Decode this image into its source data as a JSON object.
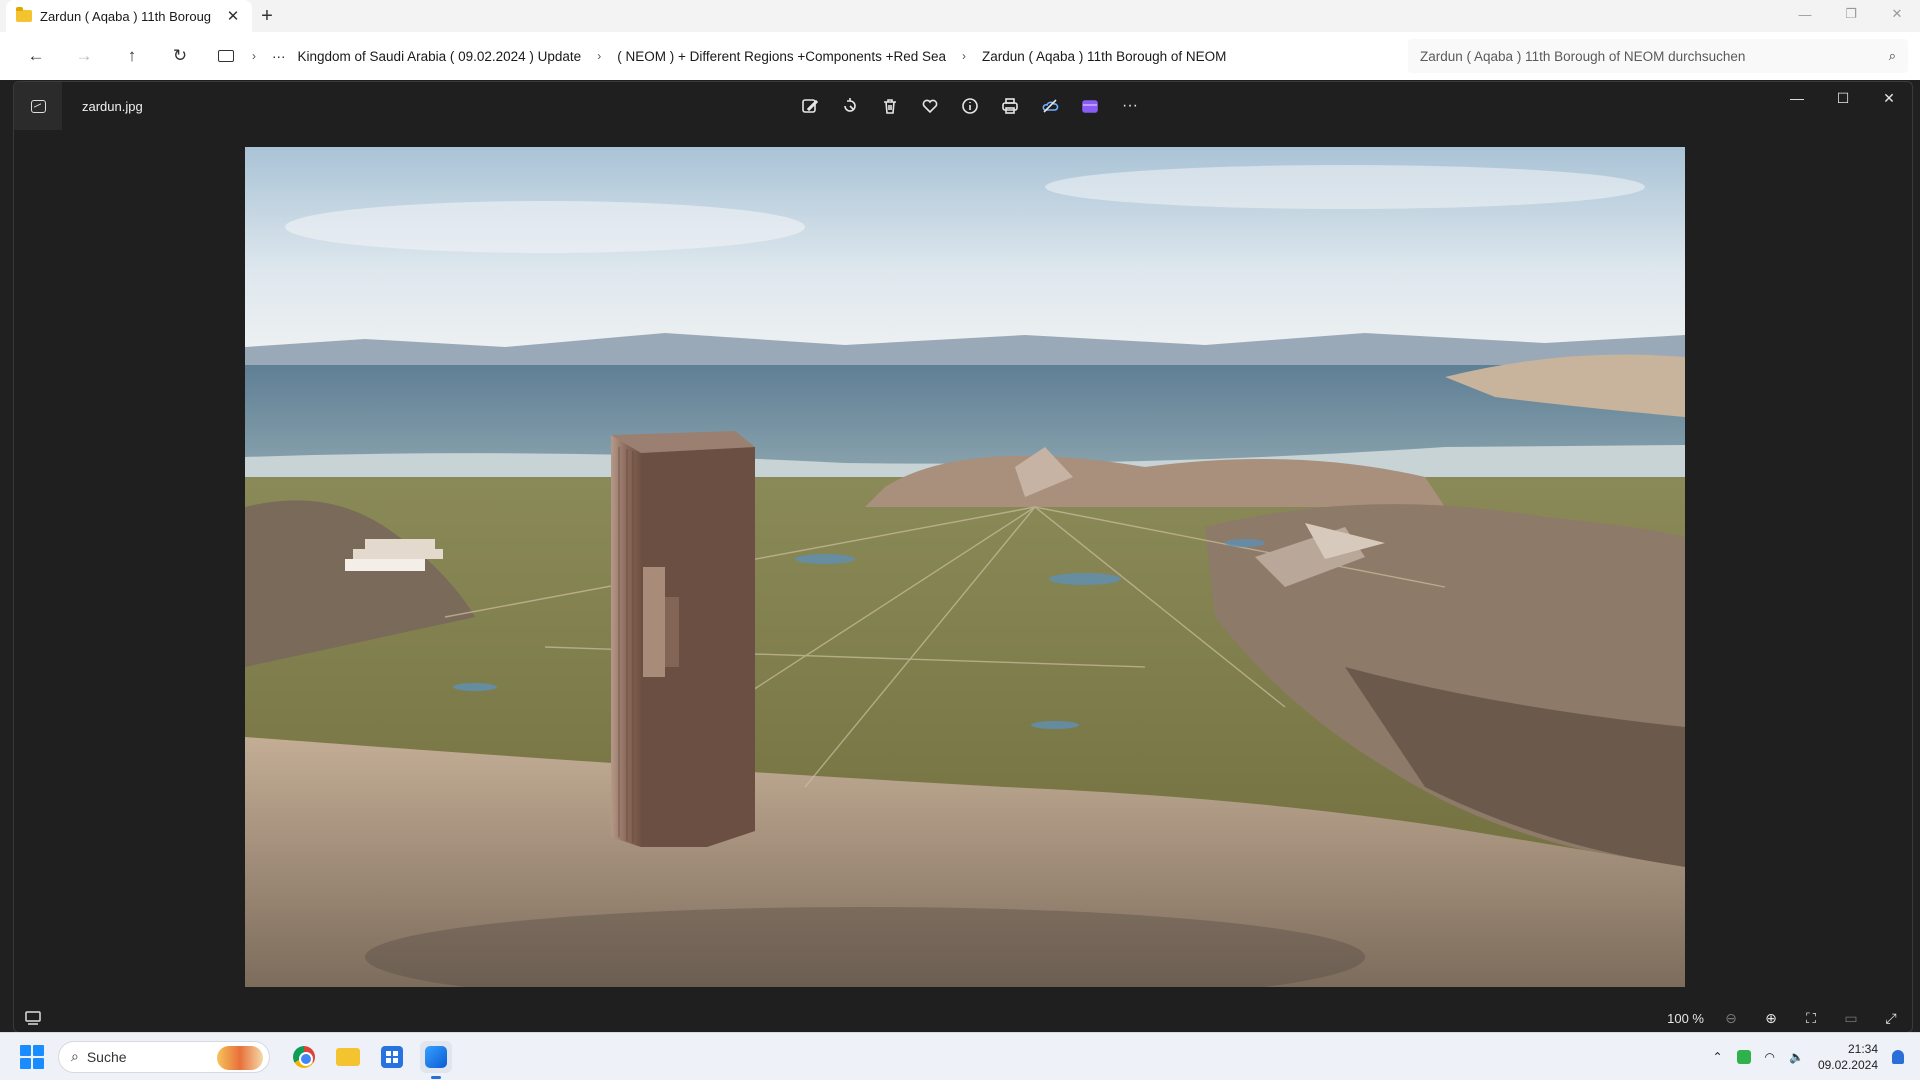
{
  "explorer": {
    "tab_title": "Zardun ( Aqaba )  11th Boroug",
    "tab_close": "✕",
    "new_tab": "+",
    "window_controls": [
      "—",
      "❐",
      "✕"
    ],
    "nav": {
      "back": "←",
      "forward": "→",
      "up": "↑",
      "refresh": "↻"
    },
    "breadcrumb": {
      "more": "···",
      "items": [
        "Kingdom of Saudi Arabia ( 09.02.2024 ) Update",
        "( NEOM ) + Different Regions +Components +Red Sea",
        "Zardun ( Aqaba )  11th Borough of NEOM"
      ]
    },
    "search_placeholder": "Zardun ( Aqaba )  11th Borough of NEOM durchsuchen"
  },
  "viewer": {
    "filename": "zardun.jpg",
    "toolbar_icons": [
      "edit-image-icon",
      "rotate-icon",
      "delete-icon",
      "favorite-icon",
      "info-icon",
      "print-icon",
      "onedrive-icon",
      "clipchamp-icon",
      "more-icon"
    ],
    "more_label": "···",
    "window_controls": [
      "—",
      "☐",
      "✕"
    ],
    "zoom_level": "100 %",
    "zoom_out": "⊖",
    "zoom_in": "⊕"
  },
  "taskbar": {
    "search_label": "Suche",
    "time": "21:34",
    "date": "09.02.2024",
    "tray_chevron": "⌃"
  }
}
